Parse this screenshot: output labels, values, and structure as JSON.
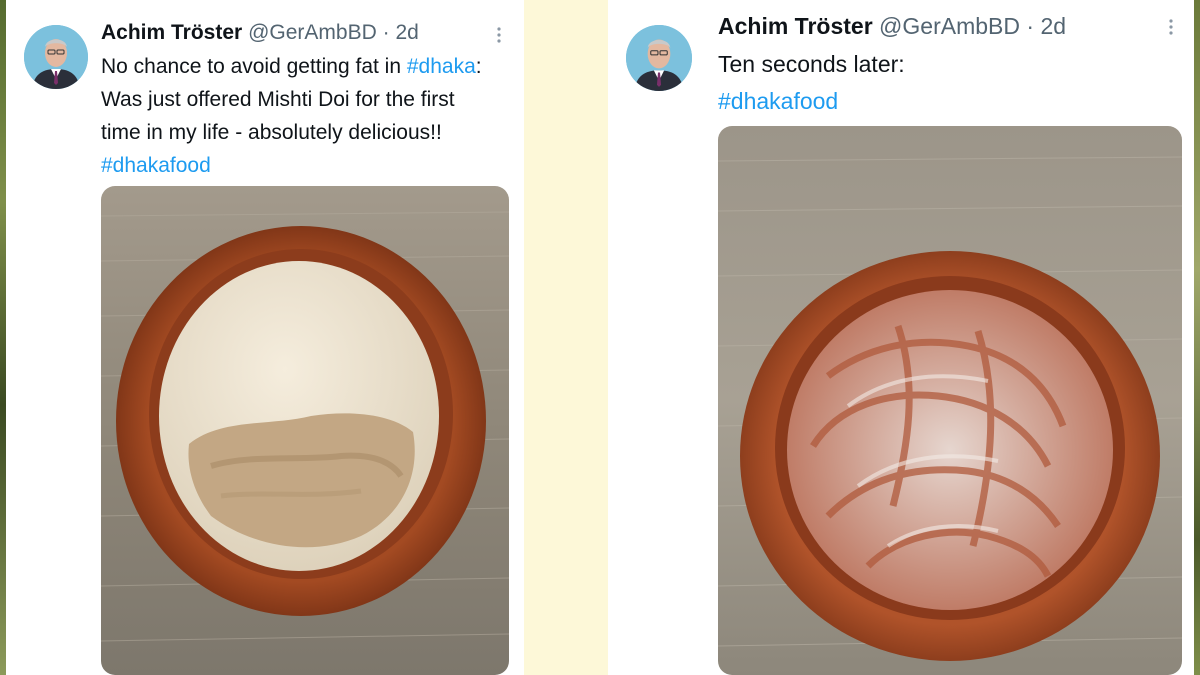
{
  "posts": [
    {
      "author": "Achim Tröster",
      "handle": "@GerAmbBD",
      "separator": "·",
      "age": "2d",
      "text_lines": [
        {
          "text": "No chance to avoid getting fat in ",
          "hashtag": "#dhaka",
          "suffix": ":"
        },
        {
          "text": "Was just offered Mishti Doi for the first"
        },
        {
          "text": "time in my life - absolutely delicious!!"
        }
      ],
      "hashtag_line": "#dhakafood",
      "media": {
        "description_icon": "mishti-doi-full-photo"
      }
    },
    {
      "author": "Achim Tröster",
      "handle": "@GerAmbBD",
      "separator": "·",
      "age": "2d",
      "text_lines": [
        {
          "text": "Ten seconds later:"
        }
      ],
      "hashtag_line": "#dhakafood",
      "media": {
        "description_icon": "mishti-doi-empty-photo"
      }
    }
  ],
  "colors": {
    "text_primary": "#0f1419",
    "text_secondary": "#536471",
    "hashtag": "#1d9bf0",
    "background_panel": "#fdf8d8"
  }
}
